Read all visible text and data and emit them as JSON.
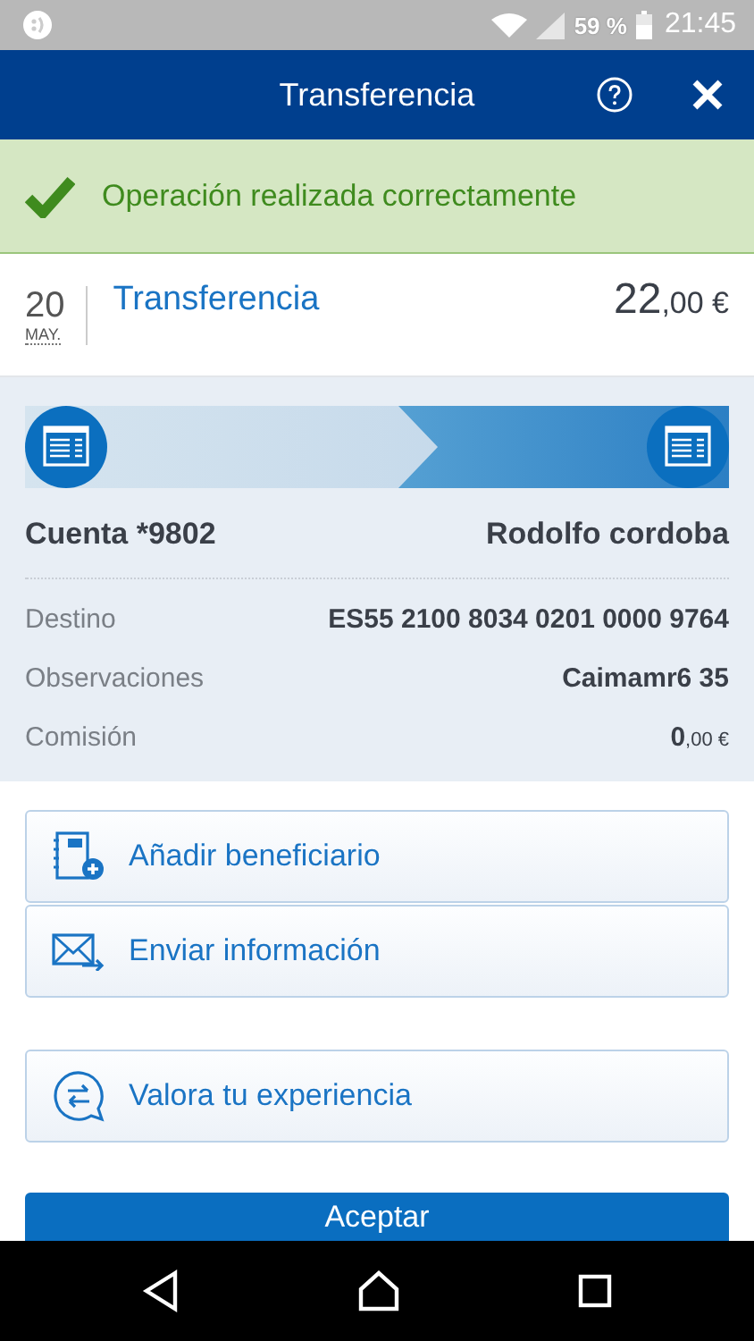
{
  "status_bar": {
    "battery": "59 %",
    "time": "21:45"
  },
  "header": {
    "title": "Transferencia"
  },
  "banner": {
    "message": "Operación realizada correctamente"
  },
  "transaction": {
    "day": "20",
    "month": "MAY.",
    "title": "Transferencia",
    "amount_integer": "22",
    "amount_decimals": ",00 €"
  },
  "details": {
    "origin": "Cuenta *9802",
    "recipient": "Rodolfo cordoba",
    "rows": [
      {
        "label": "Destino",
        "value": "ES55 2100 8034 0201 0000 9764",
        "kind": "text"
      },
      {
        "label": "Observaciones",
        "value": "Caimamr6 35",
        "kind": "text"
      },
      {
        "label": "Comisión",
        "value": "0",
        "decimals": ",00 €",
        "kind": "amount"
      }
    ]
  },
  "actions": [
    {
      "label": "Añadir beneficiario",
      "kind": "add-contact"
    },
    {
      "label": "Enviar información",
      "kind": "send-mail"
    }
  ],
  "feedback": {
    "label": "Valora tu experiencia"
  },
  "accept": {
    "label": "Aceptar"
  }
}
